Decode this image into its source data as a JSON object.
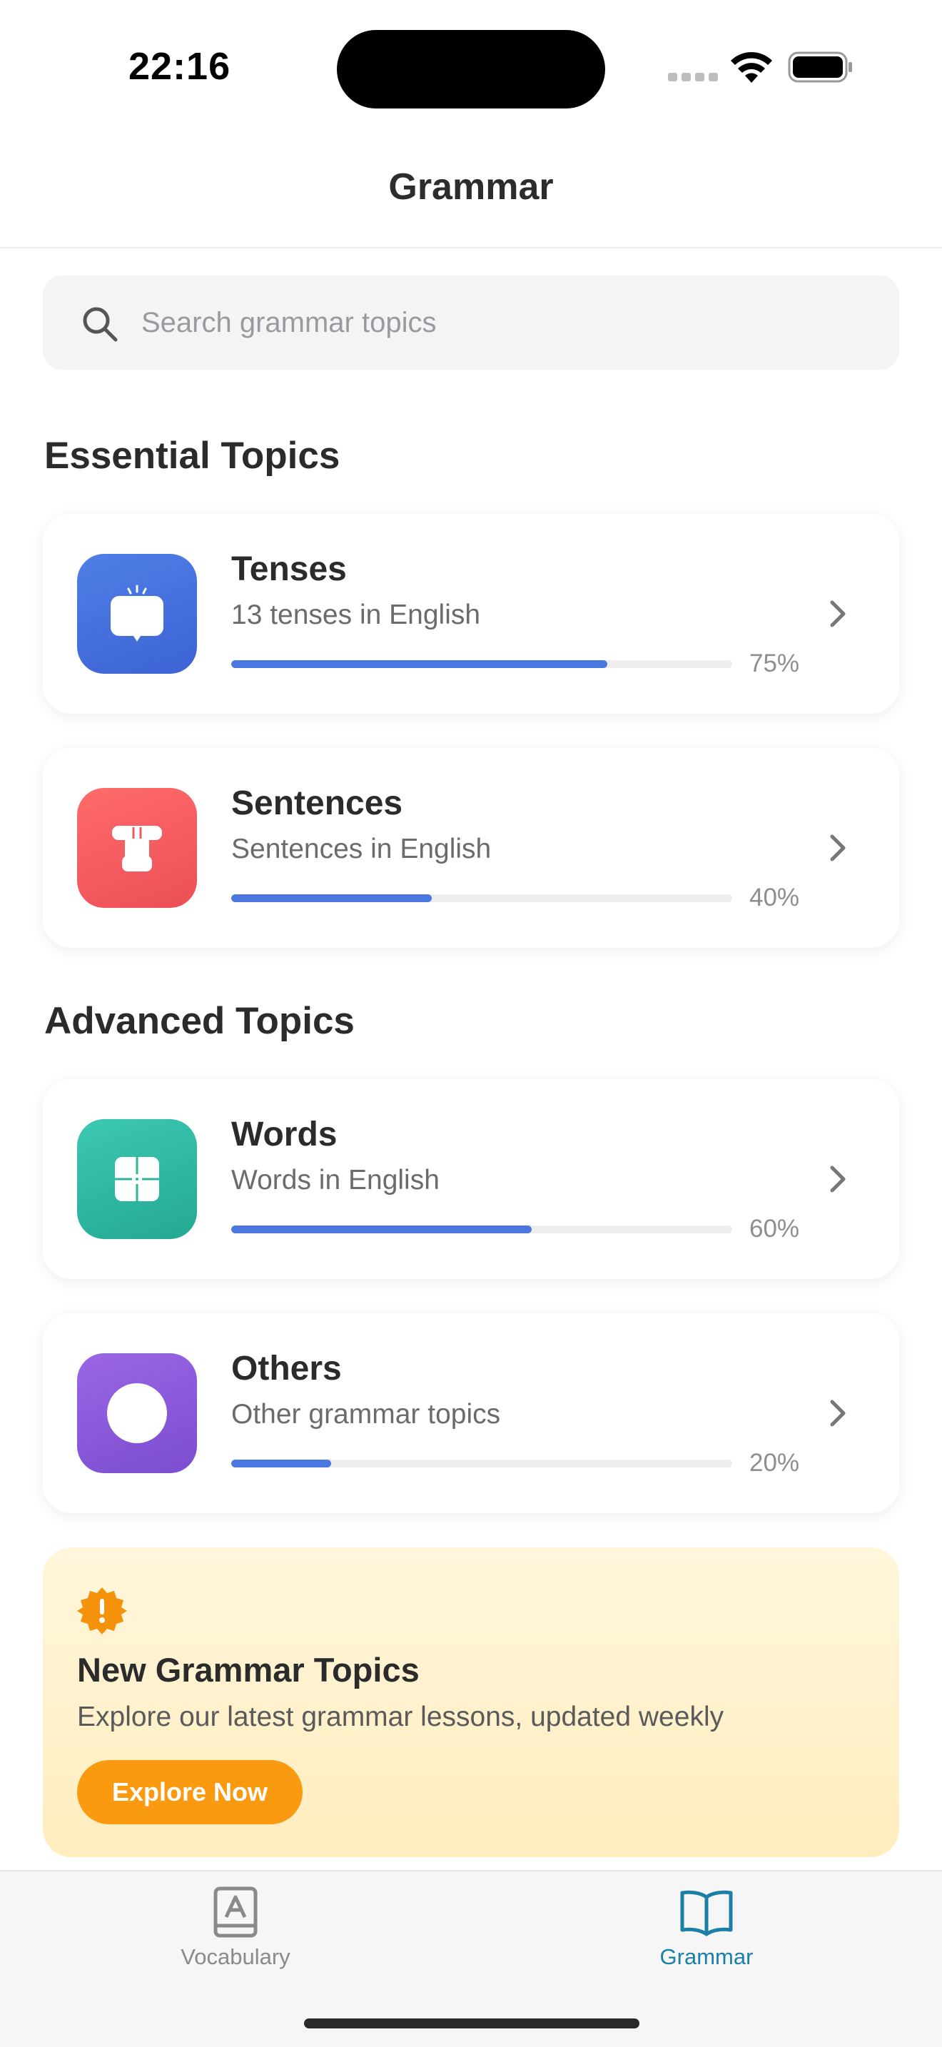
{
  "status_bar": {
    "time": "22:16"
  },
  "nav": {
    "title": "Grammar"
  },
  "search": {
    "placeholder": "Search grammar topics",
    "icon": "search-icon"
  },
  "sections": {
    "essential": "Essential Topics",
    "advanced": "Advanced Topics"
  },
  "topics": [
    {
      "title": "Tenses",
      "subtitle": "13 tenses in English",
      "progress": 75,
      "progress_label": "75%",
      "icon": "clock-icon",
      "color": "#4a74e0"
    },
    {
      "title": "Sentences",
      "subtitle": "Sentences in English",
      "progress": 40,
      "progress_label": "40%",
      "icon": "quote-icon",
      "color": "#f2585c"
    },
    {
      "title": "Words",
      "subtitle": "Words in English",
      "progress": 60,
      "progress_label": "60%",
      "icon": "words-icon",
      "color": "#2cb8a4"
    },
    {
      "title": "Others",
      "subtitle": "Other grammar topics",
      "progress": 20,
      "progress_label": "20%",
      "icon": "circle-icon",
      "color": "#8b5ad8"
    }
  ],
  "promo": {
    "title": "New Grammar Topics",
    "description": "Explore our latest grammar lessons, updated weekly",
    "button": "Explore Now",
    "icon": "alert-badge-icon"
  },
  "tabs": [
    {
      "label": "Vocabulary",
      "icon": "book-a-icon",
      "active": false
    },
    {
      "label": "Grammar",
      "icon": "open-book-icon",
      "active": true
    }
  ],
  "colors": {
    "accent": "#4a78e0",
    "tab_active": "#1b7fa8",
    "tab_inactive": "#8a8a8a",
    "promo_button": "#f99a10"
  }
}
